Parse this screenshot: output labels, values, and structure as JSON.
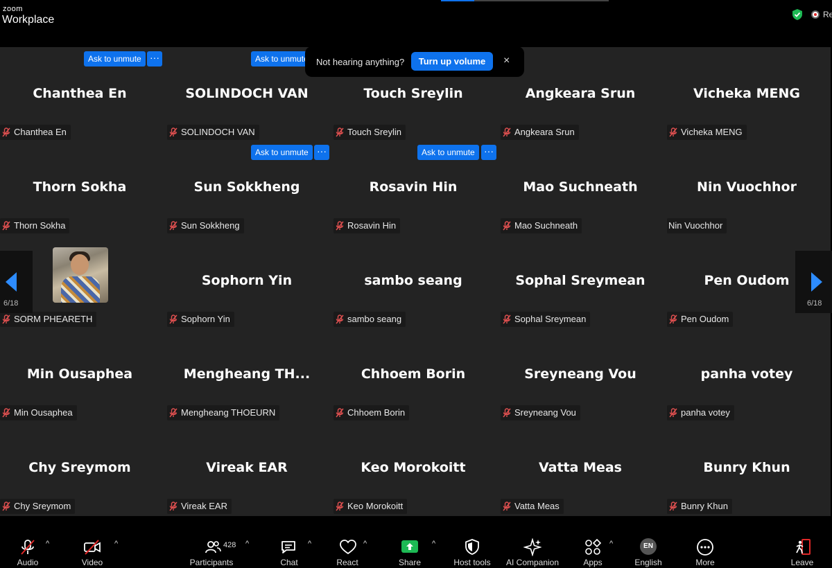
{
  "app": {
    "logo_top": "zoom",
    "logo_bottom": "Workplace",
    "recording_label": "Re",
    "top_progress_fraction": 0.2
  },
  "accent": "#0e72ed",
  "notice": {
    "text": "Not hearing anything?",
    "button": "Turn up volume",
    "close": "×"
  },
  "ask_to_unmute": "Ask to unmute",
  "more_dots": "···",
  "page": {
    "left": "6/18",
    "right": "6/18"
  },
  "participants": [
    {
      "name": "Chanthea En",
      "label": "Chanthea En",
      "muted": true
    },
    {
      "name": "SOLINDOCH VAN",
      "label": "SOLINDOCH VAN",
      "muted": true
    },
    {
      "name": "Touch Sreylin",
      "label": "Touch Sreylin",
      "muted": true
    },
    {
      "name": "Angkeara Srun",
      "label": "Angkeara Srun",
      "muted": true
    },
    {
      "name": "Vicheka MENG",
      "label": "Vicheka MENG",
      "muted": true
    },
    {
      "name": "Thorn Sokha",
      "label": "Thorn Sokha",
      "muted": true
    },
    {
      "name": "Sun Sokkheng",
      "label": "Sun Sokkheng",
      "muted": true
    },
    {
      "name": "Rosavin Hin",
      "label": "Rosavin Hin",
      "muted": true
    },
    {
      "name": "Mao Suchneath",
      "label": "Mao Suchneath",
      "muted": true
    },
    {
      "name": "Nin Vuochhor",
      "label": "Nin Vuochhor",
      "muted": false
    },
    {
      "name": "",
      "label": "SORM PHEARETH",
      "muted": true,
      "photo": true
    },
    {
      "name": "Sophorn Yin",
      "label": "Sophorn Yin",
      "muted": true
    },
    {
      "name": "sambo seang",
      "label": "sambo seang",
      "muted": true
    },
    {
      "name": "Sophal Sreymean",
      "label": "Sophal Sreymean",
      "muted": true
    },
    {
      "name": "Pen Oudom",
      "label": "Pen Oudom",
      "muted": true
    },
    {
      "name": "Min Ousaphea",
      "label": "Min Ousaphea",
      "muted": true
    },
    {
      "name": "Mengheang  TH...",
      "label": "Mengheang THOEURN",
      "muted": true
    },
    {
      "name": "Chhoem Borin",
      "label": "Chhoem Borin",
      "muted": true
    },
    {
      "name": "Sreyneang Vou",
      "label": "Sreyneang Vou",
      "muted": true
    },
    {
      "name": "panha votey",
      "label": "panha votey",
      "muted": true
    },
    {
      "name": "Chy Sreymom",
      "label": "Chy Sreymom",
      "muted": true
    },
    {
      "name": "Vireak EAR",
      "label": "Vireak EAR",
      "muted": true
    },
    {
      "name": "Keo Morokoitt",
      "label": "Keo Morokoitt",
      "muted": true
    },
    {
      "name": "Vatta Meas",
      "label": "Vatta Meas",
      "muted": true
    },
    {
      "name": "Bunry Khun",
      "label": "Bunry Khun",
      "muted": true
    }
  ],
  "toolbar": {
    "audio": "Audio",
    "video": "Video",
    "participants": "Participants",
    "participants_count": "428",
    "chat": "Chat",
    "react": "React",
    "share": "Share",
    "host_tools": "Host tools",
    "ai_companion": "AI Companion",
    "apps": "Apps",
    "language": "English",
    "language_badge": "EN",
    "more": "More",
    "leave": "Leave",
    "caret": "^"
  },
  "icons": [
    "mic-muted-icon",
    "video-off-icon",
    "participants-icon",
    "chat-icon",
    "react-heart-icon",
    "share-screen-icon",
    "host-shield-icon",
    "ai-sparkle-icon",
    "apps-icon",
    "language-icon",
    "more-icon",
    "leave-icon",
    "security-shield-icon"
  ]
}
